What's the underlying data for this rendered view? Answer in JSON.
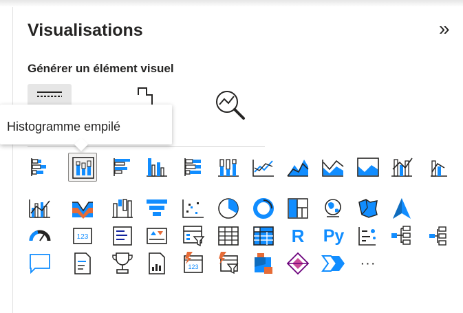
{
  "pane": {
    "title": "Visualisations",
    "subtitle": "Générer un élément visuel",
    "collapse_icon": "double-chevron-right-icon"
  },
  "tooltip": {
    "text": "Histogramme empilé"
  },
  "mode_tabs": [
    {
      "icon": "build-visual-icon",
      "selected": true
    },
    {
      "icon": "format-visual-icon",
      "selected": false
    },
    {
      "icon": "analytics-icon",
      "selected": false
    }
  ],
  "icon_labels": {
    "r": "R",
    "py": "Py",
    "more": "···"
  },
  "colors": {
    "blue": "#118dff",
    "dark": "#252423",
    "navy": "#12239e",
    "orange": "#e66c37",
    "purple": "#6b007b",
    "pink": "#c94b9a"
  },
  "visuals": [
    [
      "stacked-bar-chart-icon",
      "stacked-column-chart-icon",
      "clustered-bar-chart-icon",
      "clustered-column-chart-icon",
      "100-stacked-bar-chart-icon",
      "100-stacked-column-chart-icon",
      "line-chart-icon",
      "area-chart-icon",
      "stacked-area-chart-icon",
      "100-stacked-area-chart-icon",
      "line-and-stacked-column-icon"
    ],
    [
      "line-and-clustered-column-icon",
      "ribbon-chart-icon",
      "waterfall-chart-icon",
      "funnel-icon",
      "scatter-chart-icon",
      "pie-chart-icon",
      "donut-chart-icon",
      "treemap-icon",
      "map-icon",
      "filled-map-icon",
      "azure-map-icon"
    ],
    [
      "gauge-icon",
      "card-icon",
      "multi-row-card-icon",
      "kpi-icon",
      "slicer-icon",
      "table-icon",
      "matrix-icon",
      "r-script-visual-icon",
      "python-visual-icon",
      "key-influencers-icon",
      "decomposition-tree-icon"
    ],
    [
      "qa-icon",
      "smart-narrative-icon",
      "metrics-icon",
      "paginated-report-icon",
      "power-apps-icon",
      "power-automate-icon",
      "fabric-icon",
      "arcgis-icon",
      "copilot-icon",
      "more-visuals-icon",
      "get-more-visuals-icon"
    ]
  ]
}
